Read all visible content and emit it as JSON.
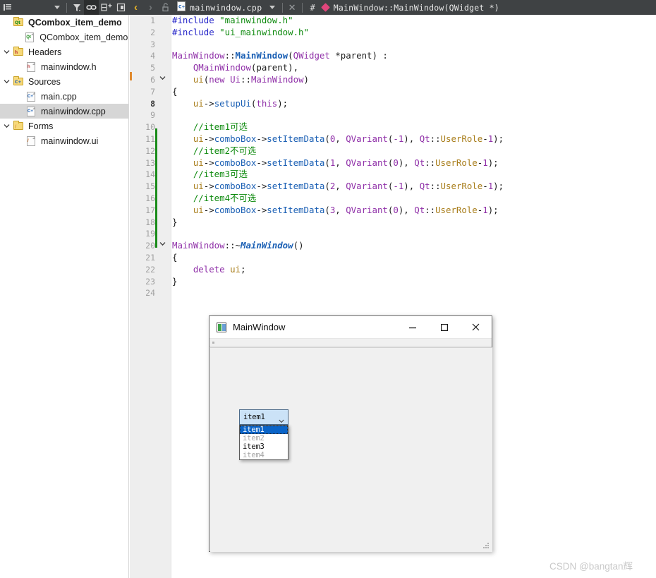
{
  "toolbar": {
    "icons": [
      {
        "name": "list-icon",
        "glyph": "≣"
      },
      {
        "name": "chevron-down-icon",
        "glyph": "▾"
      },
      {
        "name": "filter-icon",
        "glyph": "∇"
      },
      {
        "name": "link-icon",
        "glyph": "🔗"
      },
      {
        "name": "split-add-icon",
        "glyph": "⊞"
      },
      {
        "name": "panel-icon",
        "glyph": "▣"
      }
    ],
    "nav_back": "‹",
    "nav_forward": "›",
    "lock_icon": "unlock-icon",
    "open_file_tab": "mainwindow.cpp",
    "file_tab_dropdown": "▾",
    "close_tab": "✕",
    "hash_symbol": "#",
    "current_symbol": "MainWindow::MainWindow(QWidget *)"
  },
  "sidebar": {
    "items": [
      {
        "label": "QCombox_item_demo",
        "icon": "qt-project-folder-icon",
        "indent": 0,
        "twisty": "",
        "bold": true,
        "selected": false,
        "kind": "folder",
        "badge": "Qt",
        "badge_color": "#1a8c1a"
      },
      {
        "label": "QCombox_item_demo.pr",
        "icon": "qt-project-file-icon",
        "indent": 1,
        "twisty": "",
        "bold": false,
        "selected": false,
        "kind": "page",
        "badge": "Qt",
        "badge_color": "#1a8c1a"
      },
      {
        "label": "Headers",
        "icon": "headers-folder-icon",
        "indent": 0,
        "twisty": "down",
        "bold": false,
        "selected": false,
        "kind": "folder",
        "badge": "h",
        "badge_color": "#c23a3a"
      },
      {
        "label": "mainwindow.h",
        "icon": "header-file-icon",
        "indent": 1,
        "twisty": "",
        "bold": false,
        "selected": false,
        "kind": "page",
        "badge": "h",
        "badge_color": "#c23a3a"
      },
      {
        "label": "Sources",
        "icon": "sources-folder-icon",
        "indent": 0,
        "twisty": "down",
        "bold": false,
        "selected": false,
        "kind": "folder",
        "badge": "C+",
        "badge_color": "#1a5fb4"
      },
      {
        "label": "main.cpp",
        "icon": "cpp-file-icon",
        "indent": 1,
        "twisty": "",
        "bold": false,
        "selected": false,
        "kind": "page",
        "badge": "C+",
        "badge_color": "#1a5fb4"
      },
      {
        "label": "mainwindow.cpp",
        "icon": "cpp-file-icon",
        "indent": 1,
        "twisty": "",
        "bold": false,
        "selected": true,
        "kind": "page",
        "badge": "C+",
        "badge_color": "#1a5fb4"
      },
      {
        "label": "Forms",
        "icon": "forms-folder-icon",
        "indent": 0,
        "twisty": "down",
        "bold": false,
        "selected": false,
        "kind": "folder",
        "badge": "/",
        "badge_color": "#d97a2b"
      },
      {
        "label": "mainwindow.ui",
        "icon": "ui-file-icon",
        "indent": 1,
        "twisty": "",
        "bold": false,
        "selected": false,
        "kind": "page",
        "badge": "/",
        "badge_color": "#d97a2b"
      }
    ]
  },
  "editor": {
    "current_line": 8,
    "modified_marker_lines": [
      9,
      17
    ],
    "fold_indicator_lines": [
      6,
      20
    ],
    "lines": [
      {
        "n": 1,
        "tokens": [
          {
            "t": "pre",
            "v": "#include"
          },
          {
            "t": "plain",
            "v": " "
          },
          {
            "t": "str",
            "v": "\"mainwindow.h\""
          }
        ]
      },
      {
        "n": 2,
        "tokens": [
          {
            "t": "pre",
            "v": "#include"
          },
          {
            "t": "plain",
            "v": " "
          },
          {
            "t": "str",
            "v": "\"ui_mainwindow.h\""
          }
        ]
      },
      {
        "n": 3,
        "tokens": []
      },
      {
        "n": 4,
        "tokens": [
          {
            "t": "cls",
            "v": "MainWindow"
          },
          {
            "t": "plain",
            "v": "::"
          },
          {
            "t": "fn",
            "v": "MainWindow"
          },
          {
            "t": "plain",
            "v": "("
          },
          {
            "t": "cls",
            "v": "QWidget"
          },
          {
            "t": "plain",
            "v": " *parent) :"
          }
        ]
      },
      {
        "n": 5,
        "tokens": [
          {
            "t": "plain",
            "v": "    "
          },
          {
            "t": "cls",
            "v": "QMainWindow"
          },
          {
            "t": "plain",
            "v": "(parent),"
          }
        ]
      },
      {
        "n": 6,
        "tokens": [
          {
            "t": "plain",
            "v": "    "
          },
          {
            "t": "field",
            "v": "ui"
          },
          {
            "t": "plain",
            "v": "("
          },
          {
            "t": "kw",
            "v": "new"
          },
          {
            "t": "plain",
            "v": " "
          },
          {
            "t": "cls",
            "v": "Ui"
          },
          {
            "t": "plain",
            "v": "::"
          },
          {
            "t": "cls",
            "v": "MainWindow"
          },
          {
            "t": "plain",
            "v": ")"
          }
        ]
      },
      {
        "n": 7,
        "tokens": [
          {
            "t": "plain",
            "v": "{"
          }
        ]
      },
      {
        "n": 8,
        "tokens": [
          {
            "t": "plain",
            "v": "    "
          },
          {
            "t": "field",
            "v": "ui"
          },
          {
            "t": "plain",
            "v": "->"
          },
          {
            "t": "mem",
            "v": "setupUi"
          },
          {
            "t": "plain",
            "v": "("
          },
          {
            "t": "kw",
            "v": "this"
          },
          {
            "t": "plain",
            "v": ");"
          }
        ]
      },
      {
        "n": 9,
        "tokens": []
      },
      {
        "n": 10,
        "tokens": [
          {
            "t": "plain",
            "v": "    "
          },
          {
            "t": "cmt",
            "v": "//item1可选"
          }
        ]
      },
      {
        "n": 11,
        "tokens": [
          {
            "t": "plain",
            "v": "    "
          },
          {
            "t": "field",
            "v": "ui"
          },
          {
            "t": "plain",
            "v": "->"
          },
          {
            "t": "mem",
            "v": "comboBox"
          },
          {
            "t": "plain",
            "v": "->"
          },
          {
            "t": "mem",
            "v": "setItemData"
          },
          {
            "t": "plain",
            "v": "("
          },
          {
            "t": "num",
            "v": "0"
          },
          {
            "t": "plain",
            "v": ", "
          },
          {
            "t": "cls",
            "v": "QVariant"
          },
          {
            "t": "plain",
            "v": "("
          },
          {
            "t": "num",
            "v": "-1"
          },
          {
            "t": "plain",
            "v": "), "
          },
          {
            "t": "cls",
            "v": "Qt"
          },
          {
            "t": "plain",
            "v": "::"
          },
          {
            "t": "field",
            "v": "UserRole"
          },
          {
            "t": "plain",
            "v": "-"
          },
          {
            "t": "num",
            "v": "1"
          },
          {
            "t": "plain",
            "v": ");"
          }
        ]
      },
      {
        "n": 12,
        "tokens": [
          {
            "t": "plain",
            "v": "    "
          },
          {
            "t": "cmt",
            "v": "//item2不可选"
          }
        ]
      },
      {
        "n": 13,
        "tokens": [
          {
            "t": "plain",
            "v": "    "
          },
          {
            "t": "field",
            "v": "ui"
          },
          {
            "t": "plain",
            "v": "->"
          },
          {
            "t": "mem",
            "v": "comboBox"
          },
          {
            "t": "plain",
            "v": "->"
          },
          {
            "t": "mem",
            "v": "setItemData"
          },
          {
            "t": "plain",
            "v": "("
          },
          {
            "t": "num",
            "v": "1"
          },
          {
            "t": "plain",
            "v": ", "
          },
          {
            "t": "cls",
            "v": "QVariant"
          },
          {
            "t": "plain",
            "v": "("
          },
          {
            "t": "num",
            "v": "0"
          },
          {
            "t": "plain",
            "v": "), "
          },
          {
            "t": "cls",
            "v": "Qt"
          },
          {
            "t": "plain",
            "v": "::"
          },
          {
            "t": "field",
            "v": "UserRole"
          },
          {
            "t": "plain",
            "v": "-"
          },
          {
            "t": "num",
            "v": "1"
          },
          {
            "t": "plain",
            "v": ");"
          }
        ]
      },
      {
        "n": 14,
        "tokens": [
          {
            "t": "plain",
            "v": "    "
          },
          {
            "t": "cmt",
            "v": "//item3可选"
          }
        ]
      },
      {
        "n": 15,
        "tokens": [
          {
            "t": "plain",
            "v": "    "
          },
          {
            "t": "field",
            "v": "ui"
          },
          {
            "t": "plain",
            "v": "->"
          },
          {
            "t": "mem",
            "v": "comboBox"
          },
          {
            "t": "plain",
            "v": "->"
          },
          {
            "t": "mem",
            "v": "setItemData"
          },
          {
            "t": "plain",
            "v": "("
          },
          {
            "t": "num",
            "v": "2"
          },
          {
            "t": "plain",
            "v": ", "
          },
          {
            "t": "cls",
            "v": "QVariant"
          },
          {
            "t": "plain",
            "v": "("
          },
          {
            "t": "num",
            "v": "-1"
          },
          {
            "t": "plain",
            "v": "), "
          },
          {
            "t": "cls",
            "v": "Qt"
          },
          {
            "t": "plain",
            "v": "::"
          },
          {
            "t": "field",
            "v": "UserRole"
          },
          {
            "t": "plain",
            "v": "-"
          },
          {
            "t": "num",
            "v": "1"
          },
          {
            "t": "plain",
            "v": ");"
          }
        ]
      },
      {
        "n": 16,
        "tokens": [
          {
            "t": "plain",
            "v": "    "
          },
          {
            "t": "cmt",
            "v": "//item4不可选"
          }
        ]
      },
      {
        "n": 17,
        "tokens": [
          {
            "t": "plain",
            "v": "    "
          },
          {
            "t": "field",
            "v": "ui"
          },
          {
            "t": "plain",
            "v": "->"
          },
          {
            "t": "mem",
            "v": "comboBox"
          },
          {
            "t": "plain",
            "v": "->"
          },
          {
            "t": "mem",
            "v": "setItemData"
          },
          {
            "t": "plain",
            "v": "("
          },
          {
            "t": "num",
            "v": "3"
          },
          {
            "t": "plain",
            "v": ", "
          },
          {
            "t": "cls",
            "v": "QVariant"
          },
          {
            "t": "plain",
            "v": "("
          },
          {
            "t": "num",
            "v": "0"
          },
          {
            "t": "plain",
            "v": "), "
          },
          {
            "t": "cls",
            "v": "Qt"
          },
          {
            "t": "plain",
            "v": "::"
          },
          {
            "t": "field",
            "v": "UserRole"
          },
          {
            "t": "plain",
            "v": "-"
          },
          {
            "t": "num",
            "v": "1"
          },
          {
            "t": "plain",
            "v": ");"
          }
        ]
      },
      {
        "n": 18,
        "tokens": [
          {
            "t": "plain",
            "v": "}"
          }
        ]
      },
      {
        "n": 19,
        "tokens": []
      },
      {
        "n": 20,
        "tokens": [
          {
            "t": "cls",
            "v": "MainWindow"
          },
          {
            "t": "plain",
            "v": "::~"
          },
          {
            "t": "fnd",
            "v": "MainWindow"
          },
          {
            "t": "plain",
            "v": "()"
          }
        ]
      },
      {
        "n": 21,
        "tokens": [
          {
            "t": "plain",
            "v": "{"
          }
        ]
      },
      {
        "n": 22,
        "tokens": [
          {
            "t": "plain",
            "v": "    "
          },
          {
            "t": "kw",
            "v": "delete"
          },
          {
            "t": "plain",
            "v": " "
          },
          {
            "t": "field",
            "v": "ui"
          },
          {
            "t": "plain",
            "v": ";"
          }
        ]
      },
      {
        "n": 23,
        "tokens": [
          {
            "t": "plain",
            "v": "}"
          }
        ]
      },
      {
        "n": 24,
        "tokens": []
      }
    ]
  },
  "qt_window": {
    "title": "MainWindow",
    "minimize_label": "—",
    "maximize_label": "☐",
    "close_label": "✕",
    "combobox": {
      "selected_value": "item1",
      "expanded": true,
      "options": [
        {
          "label": "item1",
          "selected": true,
          "disabled": false
        },
        {
          "label": "item2",
          "selected": false,
          "disabled": true
        },
        {
          "label": "item3",
          "selected": false,
          "disabled": false
        },
        {
          "label": "item4",
          "selected": false,
          "disabled": true
        }
      ]
    }
  },
  "watermark": "CSDN @bangtan辉",
  "colors": {
    "toolbar_bg": "#3f4244",
    "selection_blue": "#0a64c8",
    "combo_field_blue": "#cbe2f7",
    "modified_green": "#1a8c1a",
    "symbol_pink": "#e0457b",
    "tree_selected": "#d6d6d6"
  }
}
